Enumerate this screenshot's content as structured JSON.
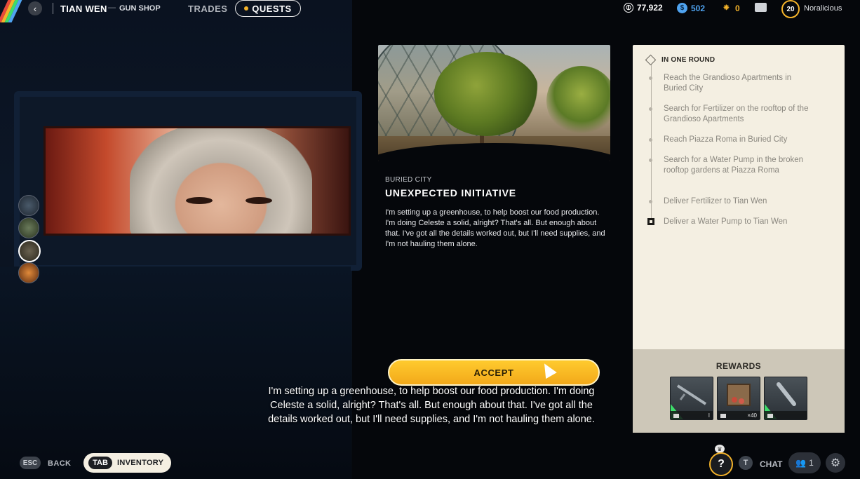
{
  "header": {
    "trader_name": "TIAN WEN",
    "trader_separator": "—",
    "trader_role": "GUN SHOP",
    "tabs": [
      {
        "label": "TRADES"
      },
      {
        "label": "QUESTS"
      }
    ]
  },
  "currencies": [
    {
      "icon": "coin-icon",
      "value": "77,922"
    },
    {
      "icon": "credit-icon",
      "value": "502"
    },
    {
      "icon": "token-icon",
      "value": "0"
    }
  ],
  "user": {
    "level": "20",
    "name": "Noralicious"
  },
  "quest": {
    "location": "BURIED CITY",
    "title": "UNEXPECTED INITIATIVE",
    "description": "I'm setting up a greenhouse, to help boost our food production. I'm doing Celeste a solid, alright? That's all. But enough about that. I've got all the details worked out, but I'll need supplies, and I'm not hauling them alone."
  },
  "objectives": {
    "header": "IN ONE ROUND",
    "items": [
      {
        "text": "Reach the Grandioso Apartments in Buried City"
      },
      {
        "text": "Search for Fertilizer on the rooftop of the Grandioso Apartments"
      },
      {
        "text": "Reach Piazza Roma in Buried City"
      },
      {
        "text": "Search for a Water Pump in the broken rooftop gardens at Piazza Roma"
      },
      {
        "text": "Deliver Fertilizer to Tian Wen"
      },
      {
        "text": "Deliver a Water Pump to Tian Wen"
      }
    ]
  },
  "rewards": {
    "title": "REWARDS",
    "items": [
      {
        "icon": "rifle-icon",
        "qty": "I"
      },
      {
        "icon": "crate-icon",
        "qty": "×40"
      },
      {
        "icon": "canister-icon",
        "qty": ""
      }
    ]
  },
  "accept_label": "ACCEPT",
  "subtitle": "I'm setting up a greenhouse, to help boost our food production. I'm doing Celeste a solid, alright? That's all. But enough about that. I've got all the details worked out, but I'll need supplies, and I'm not hauling them alone.",
  "bottom": {
    "esc_key": "ESC",
    "back_label": "BACK",
    "tab_key": "TAB",
    "inventory_label": "INVENTORY",
    "help_glyph": "?",
    "chat_key": "T",
    "chat_label": "CHAT",
    "party_count": "1"
  },
  "colors": {
    "accent": "#f4b32a",
    "credit": "#4fa3f0",
    "panel": "#f4efe2",
    "reward_rarity": "#3ddc6a"
  }
}
